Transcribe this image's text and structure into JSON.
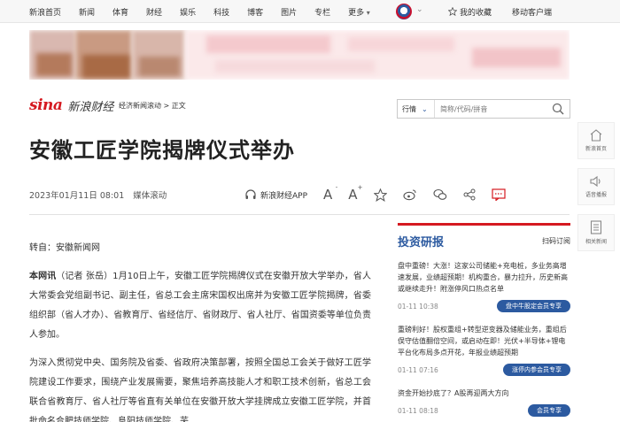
{
  "topnav": {
    "links": [
      "新浪首页",
      "新闻",
      "体育",
      "财经",
      "娱乐",
      "科技",
      "博客",
      "图片",
      "专栏",
      "更多"
    ],
    "favorites": "我的收藏",
    "mobile": "移动客户端"
  },
  "brand": {
    "logo": "sina",
    "name": "新浪财经"
  },
  "breadcrumb": {
    "section": "经济新闻滚动",
    "sep": " > ",
    "current": "正文"
  },
  "search": {
    "type": "行情",
    "placeholder": "简称/代码/拼音"
  },
  "sidetools": [
    {
      "label": "新浪首页",
      "icon": "home-icon"
    },
    {
      "label": "语音播报",
      "icon": "speaker-icon"
    },
    {
      "label": "相关新闻",
      "icon": "list-icon"
    }
  ],
  "article": {
    "title": "安徽工匠学院揭牌仪式举办",
    "date": "2023年01月11日 08:01",
    "source": "媒体滚动",
    "app_label": "新浪财经APP",
    "repost": "转自：安徽新闻网",
    "lead": "本网讯",
    "p1": "（记者 张岳）1月10日上午，安徽工匠学院揭牌仪式在安徽开放大学举办，省人大常委会党组副书记、副主任，省总工会主席宋国权出席并为安徽工匠学院揭牌，省委组织部（省人才办）、省教育厅、省经信厅、省财政厅、省人社厅、省国资委等单位负责人参加。",
    "p2": "为深入贯彻党中央、国务院及省委、省政府决策部署，按照全国总工会关于做好工匠学院建设工作要求，围绕产业发展需要，聚焦培养高技能人才和职工技术创新，省总工会联合省教育厅、省人社厅等省直有关单位在安徽开放大学挂牌成立安徽工匠学院，并首批命名合肥技师学院、阜阳技师学院、芜"
  },
  "panel": {
    "title": "投资研报",
    "subscribe": "扫码订阅",
    "items": [
      {
        "text": "盘中重磅！大涨！这家公司储能+充电桩，多业务高增速发展，业绩超预期！机构重合，暴力拉升，历史新高或继续走升！附涨停风口热点名单",
        "time": "01-11 10:38",
        "tag": "盘中牛股定会员专享"
      },
      {
        "text": "重磅利好！股权重组+转型逆变器及储能业务，重组后俣守估值翻倍空间，或启动在即！光伏+半导体+锂电平台化布局多点开花，年报业绩超预期",
        "time": "01-11 07:16",
        "tag": "涨停内参会员专享"
      },
      {
        "text": "资金开始抄底了？A股再迎两大方向",
        "time": "01-11 08:18",
        "tag": "会员专享"
      }
    ]
  },
  "colors": {
    "accent": "#d51920",
    "blue": "#2c5aa0"
  }
}
